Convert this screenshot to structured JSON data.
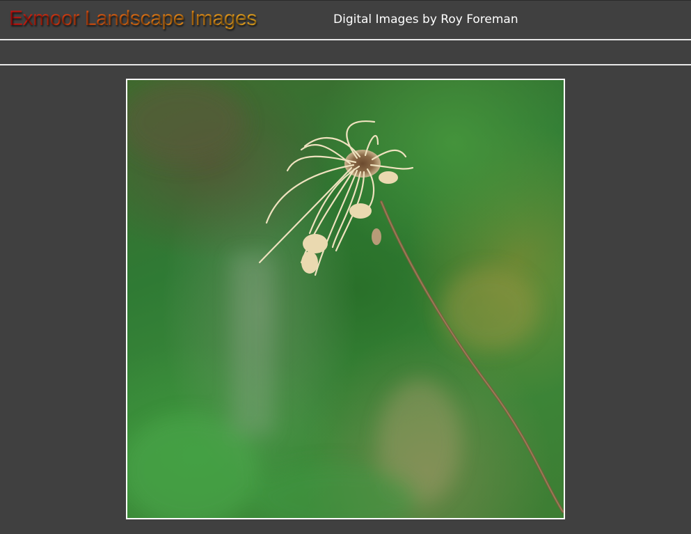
{
  "header": {
    "site_title": "Exmoor Landscape Images",
    "tagline": "Digital Images by Roy Foreman"
  },
  "photo": {
    "subject": "dried seed head on a thin stem",
    "background_color": "#3b7d34",
    "frame_color": "#ffffff"
  },
  "colors": {
    "page_background": "#404040",
    "divider": "#e8e8e8",
    "title_gradient_start": "#d41010",
    "title_gradient_end": "#f6b020",
    "tagline_text": "#ffffff"
  }
}
